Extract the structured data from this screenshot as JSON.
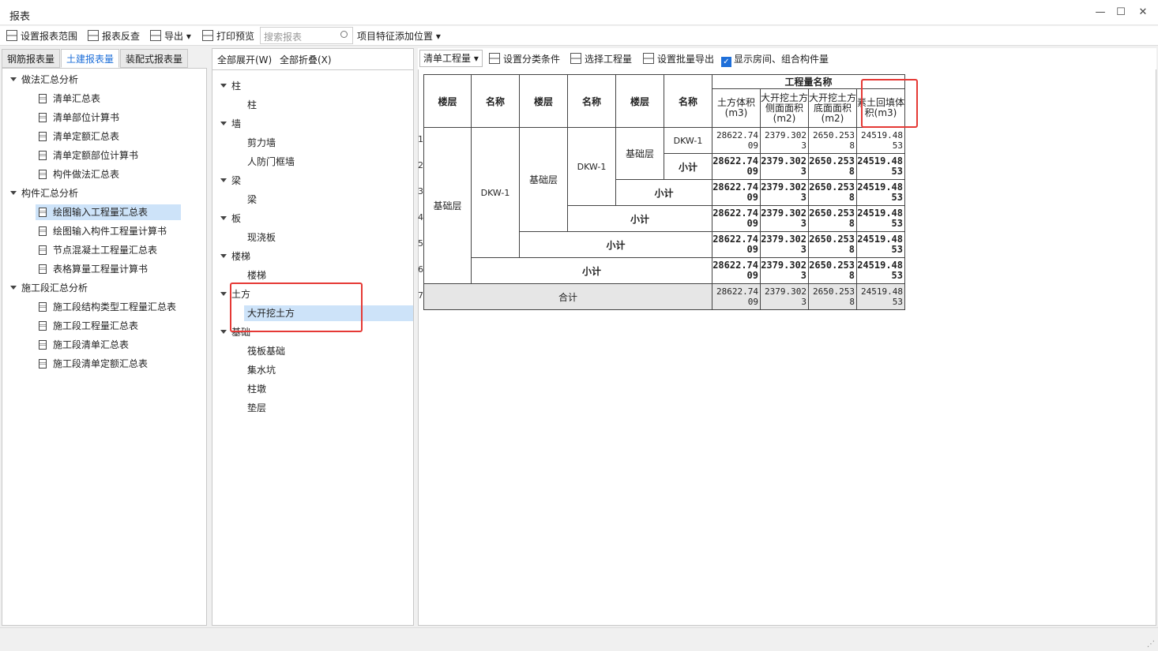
{
  "window": {
    "title": "报表",
    "min": "—",
    "max": "☐",
    "close": "✕"
  },
  "toolbar": {
    "set_range": "设置报表范围",
    "reverse": "报表反查",
    "export": "导出",
    "print": "打印预览",
    "search_placeholder": "搜索报表",
    "feature": "项目特征添加位置"
  },
  "tabs": [
    "钢筋报表量",
    "土建报表量",
    "装配式报表量"
  ],
  "left_tree": [
    {
      "label": "做法汇总分析",
      "children": [
        "清单汇总表",
        "清单部位计算书",
        "清单定额汇总表",
        "清单定额部位计算书",
        "构件做法汇总表"
      ]
    },
    {
      "label": "构件汇总分析",
      "children": [
        "绘图输入工程量汇总表",
        "绘图输入构件工程量计算书",
        "节点混凝土工程量汇总表",
        "表格算量工程量计算书"
      ]
    },
    {
      "label": "施工段汇总分析",
      "children": [
        "施工段结构类型工程量汇总表",
        "施工段工程量汇总表",
        "施工段清单汇总表",
        "施工段清单定额汇总表"
      ]
    }
  ],
  "mid": {
    "expand": "全部展开(W)",
    "collapse": "全部折叠(X)"
  },
  "mid_tree": [
    {
      "label": "柱",
      "children": [
        "柱"
      ]
    },
    {
      "label": "墙",
      "children": [
        "剪力墙",
        "人防门框墙"
      ]
    },
    {
      "label": "梁",
      "children": [
        "梁"
      ]
    },
    {
      "label": "板",
      "children": [
        "现浇板"
      ]
    },
    {
      "label": "楼梯",
      "children": [
        "楼梯"
      ]
    },
    {
      "label": "土方",
      "children": [
        "大开挖土方"
      ]
    },
    {
      "label": "基础",
      "children": [
        "筏板基础",
        "集水坑",
        "柱墩",
        "垫层"
      ]
    }
  ],
  "right_toolbar": {
    "dropdown": "清单工程量",
    "classify": "设置分类条件",
    "select_qty": "选择工程量",
    "batch_export": "设置批量导出",
    "show_room": "显示房间、组合构件量"
  },
  "table": {
    "h_floor": "楼层",
    "h_name": "名称",
    "group": "工程量名称",
    "cols": [
      "土方体积(m3)",
      "大开挖土方侧面面积(m2)",
      "大开挖土方底面面积(m2)",
      "素土回填体积(m3)"
    ],
    "floor": "基础层",
    "name": "DKW-1",
    "subtotal": "小计",
    "total": "合计",
    "values_plain": [
      "28622.7409",
      "2379.3023",
      "2650.2538",
      "24519.4853"
    ],
    "values_bold": [
      "28622.7409",
      "2379.3023",
      "2650.2538",
      "24519.4853"
    ],
    "row_numbers": [
      "1",
      "2",
      "3",
      "4",
      "5",
      "6",
      "7"
    ]
  }
}
